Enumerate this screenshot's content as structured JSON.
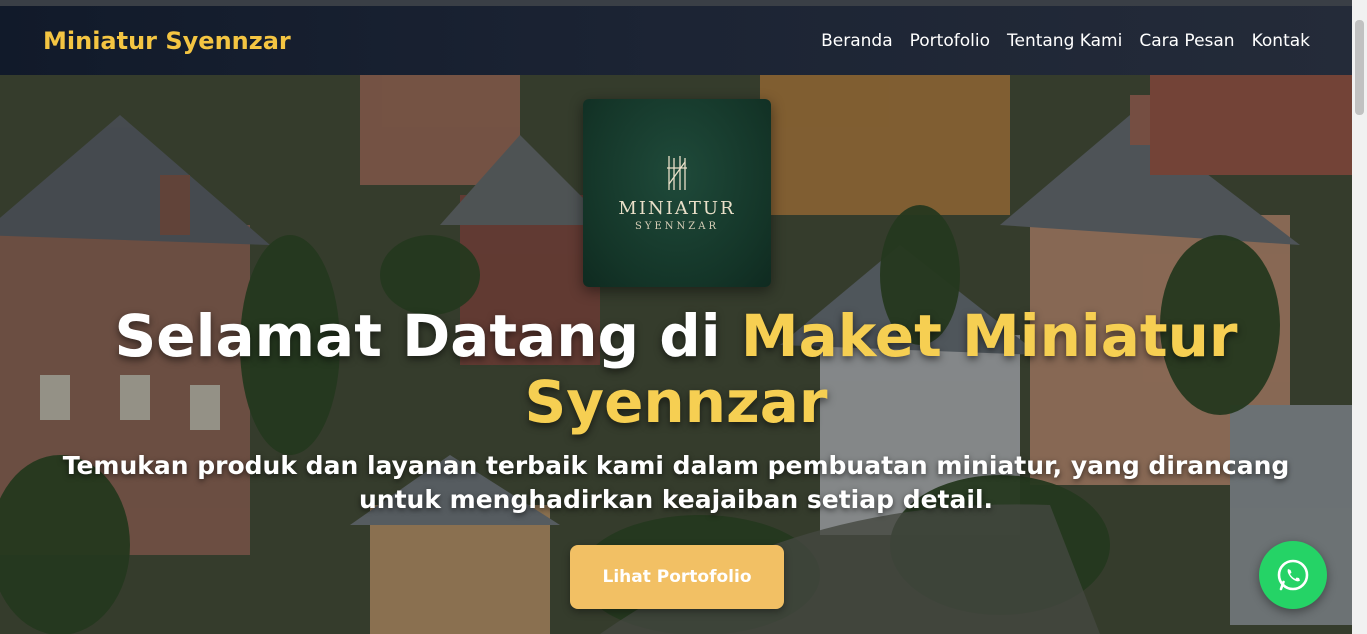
{
  "brand": {
    "name": "Miniatur Syennzar"
  },
  "nav": {
    "items": [
      {
        "label": "Beranda"
      },
      {
        "label": "Portofolio"
      },
      {
        "label": "Tentang Kami"
      },
      {
        "label": "Cara Pesan"
      },
      {
        "label": "Kontak"
      }
    ]
  },
  "hero": {
    "logo_word": "MINIATUR",
    "logo_sub": "SYENNZAR",
    "title_plain": "Selamat Datang di ",
    "title_accent_1": "Maket Miniatur",
    "title_accent_2": "Syennzar",
    "subtitle": "Temukan produk dan layanan terbaik kami dalam pembuatan miniatur, yang dirancang untuk menghadirkan keajaiban setiap detail.",
    "cta_label": "Lihat Portofolio"
  },
  "colors": {
    "accent": "#f6cf52",
    "button": "#f2c064",
    "navbar": "#1c2434",
    "whatsapp": "#25d366"
  },
  "icons": {
    "floating": "whatsapp-icon"
  }
}
